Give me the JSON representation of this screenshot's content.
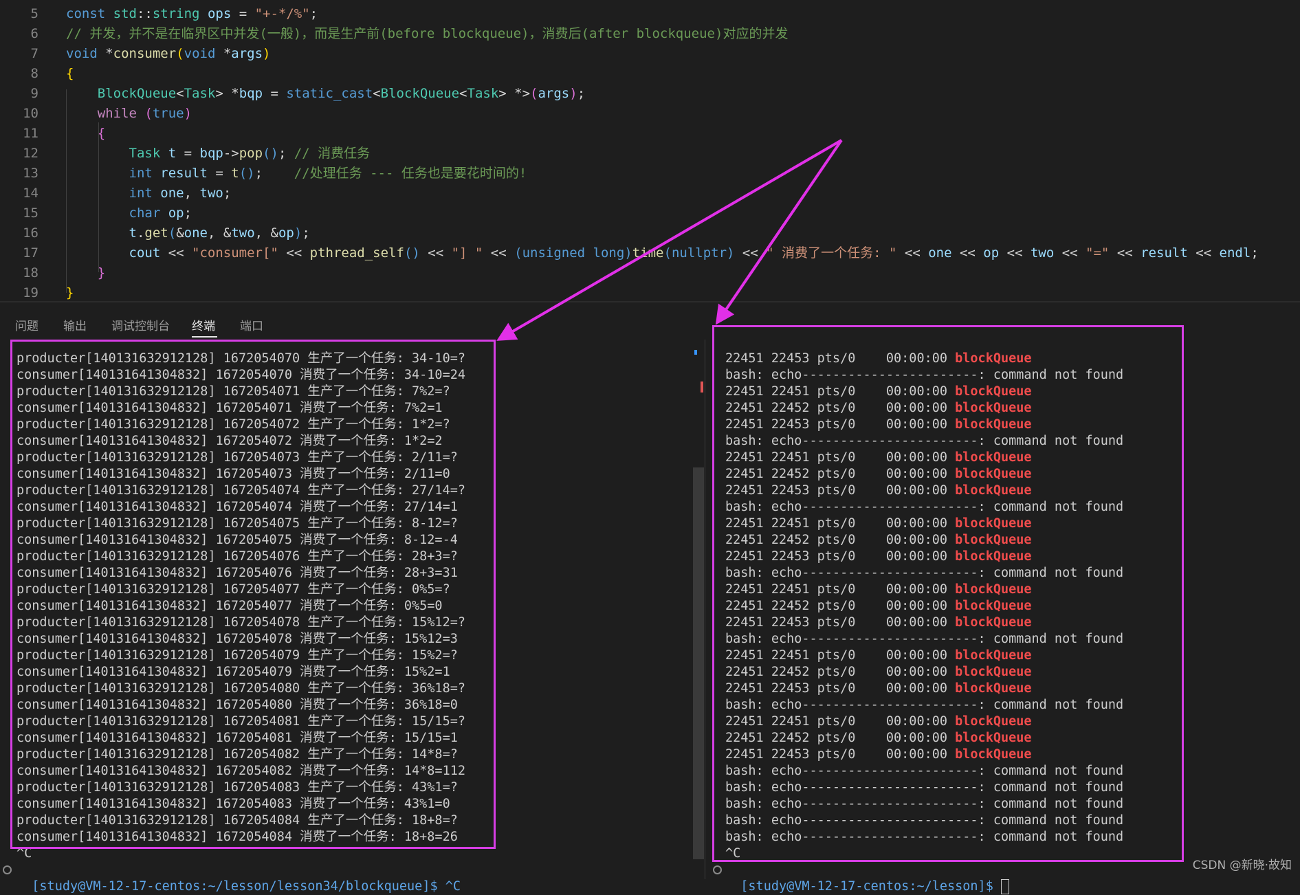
{
  "editor": {
    "lines": [
      {
        "num": "5",
        "parts": [
          [
            "kw",
            "const "
          ],
          [
            "ty",
            "std"
          ],
          [
            "pn",
            "::"
          ],
          [
            "ty",
            "string "
          ],
          [
            "vr",
            "ops"
          ],
          [
            "pn",
            " = "
          ],
          [
            "str",
            "\"+-*/%\""
          ],
          [
            "pn",
            ";"
          ]
        ]
      },
      {
        "num": "6",
        "parts": [
          [
            "cm",
            "// 并发，并不是在临界区中并发(一般)，而是生产前(before blockqueue)，消费后(after blockqueue)对应的并发"
          ]
        ]
      },
      {
        "num": "7",
        "parts": [
          [
            "kw",
            "void "
          ],
          [
            "pn",
            "*"
          ],
          [
            "fn",
            "consumer"
          ],
          [
            "br",
            "("
          ],
          [
            "kw",
            "void "
          ],
          [
            "pn",
            "*"
          ],
          [
            "vr",
            "args"
          ],
          [
            "br",
            ")"
          ]
        ]
      },
      {
        "num": "8",
        "parts": [
          [
            "br",
            "{"
          ]
        ]
      },
      {
        "num": "9",
        "parts": [
          [
            "pn",
            "    "
          ],
          [
            "ty",
            "BlockQueue"
          ],
          [
            "pn",
            "<"
          ],
          [
            "ty",
            "Task"
          ],
          [
            "pn",
            "> *"
          ],
          [
            "vr",
            "bqp"
          ],
          [
            "pn",
            " = "
          ],
          [
            "kw",
            "static_cast"
          ],
          [
            "pn",
            "<"
          ],
          [
            "ty",
            "BlockQueue"
          ],
          [
            "pn",
            "<"
          ],
          [
            "ty",
            "Task"
          ],
          [
            "pn",
            "> *>"
          ],
          [
            "br2",
            "("
          ],
          [
            "vr",
            "args"
          ],
          [
            "br2",
            ")"
          ],
          [
            "pn",
            ";"
          ]
        ]
      },
      {
        "num": "10",
        "parts": [
          [
            "pn",
            "    "
          ],
          [
            "ctl",
            "while "
          ],
          [
            "br2",
            "("
          ],
          [
            "kw",
            "true"
          ],
          [
            "br2",
            ")"
          ]
        ]
      },
      {
        "num": "11",
        "parts": [
          [
            "pn",
            "    "
          ],
          [
            "br2",
            "{"
          ]
        ]
      },
      {
        "num": "12",
        "parts": [
          [
            "pn",
            "        "
          ],
          [
            "ty",
            "Task "
          ],
          [
            "vr",
            "t"
          ],
          [
            "pn",
            " = "
          ],
          [
            "vr",
            "bqp"
          ],
          [
            "pn",
            "->"
          ],
          [
            "fn",
            "pop"
          ],
          [
            "kw",
            "()"
          ],
          [
            "pn",
            "; "
          ],
          [
            "cm",
            "// 消费任务"
          ]
        ]
      },
      {
        "num": "13",
        "parts": [
          [
            "pn",
            "        "
          ],
          [
            "kw",
            "int "
          ],
          [
            "vr",
            "result"
          ],
          [
            "pn",
            " = "
          ],
          [
            "fn",
            "t"
          ],
          [
            "kw",
            "()"
          ],
          [
            "pn",
            ";    "
          ],
          [
            "cm",
            "//处理任务 --- 任务也是要花时间的!"
          ]
        ]
      },
      {
        "num": "14",
        "parts": [
          [
            "pn",
            "        "
          ],
          [
            "kw",
            "int "
          ],
          [
            "vr",
            "one"
          ],
          [
            "pn",
            ", "
          ],
          [
            "vr",
            "two"
          ],
          [
            "pn",
            ";"
          ]
        ]
      },
      {
        "num": "15",
        "parts": [
          [
            "pn",
            "        "
          ],
          [
            "kw",
            "char "
          ],
          [
            "vr",
            "op"
          ],
          [
            "pn",
            ";"
          ]
        ]
      },
      {
        "num": "16",
        "parts": [
          [
            "pn",
            "        "
          ],
          [
            "vr",
            "t"
          ],
          [
            "pn",
            "."
          ],
          [
            "fn",
            "get"
          ],
          [
            "kw",
            "("
          ],
          [
            "pn",
            "&"
          ],
          [
            "vr",
            "one"
          ],
          [
            "pn",
            ", &"
          ],
          [
            "vr",
            "two"
          ],
          [
            "pn",
            ", &"
          ],
          [
            "vr",
            "op"
          ],
          [
            "kw",
            ")"
          ],
          [
            "pn",
            ";"
          ]
        ]
      },
      {
        "num": "17",
        "parts": [
          [
            "pn",
            "        "
          ],
          [
            "vr",
            "cout"
          ],
          [
            "pn",
            " << "
          ],
          [
            "str",
            "\"consumer[\""
          ],
          [
            "pn",
            " << "
          ],
          [
            "fn",
            "pthread_self"
          ],
          [
            "kw",
            "()"
          ],
          [
            "pn",
            " << "
          ],
          [
            "str",
            "\"] \""
          ],
          [
            "pn",
            " << "
          ],
          [
            "kw",
            "(unsigned long)"
          ],
          [
            "fn",
            "time"
          ],
          [
            "kw",
            "("
          ],
          [
            "kw",
            "nullptr"
          ],
          [
            "kw",
            ")"
          ],
          [
            "pn",
            " << "
          ],
          [
            "str",
            "\" 消费了一个任务: \""
          ],
          [
            "pn",
            " << "
          ],
          [
            "vr",
            "one"
          ],
          [
            "pn",
            " << "
          ],
          [
            "vr",
            "op"
          ],
          [
            "pn",
            " << "
          ],
          [
            "vr",
            "two"
          ],
          [
            "pn",
            " << "
          ],
          [
            "str",
            "\"=\""
          ],
          [
            "pn",
            " << "
          ],
          [
            "vr",
            "result"
          ],
          [
            "pn",
            " << "
          ],
          [
            "vr",
            "endl"
          ],
          [
            "pn",
            ";"
          ]
        ]
      },
      {
        "num": "18",
        "parts": [
          [
            "pn",
            "    "
          ],
          [
            "br2",
            "}"
          ]
        ]
      },
      {
        "num": "19",
        "parts": [
          [
            "br",
            "}"
          ]
        ]
      }
    ]
  },
  "panel_tabs": [
    "问题",
    "输出",
    "调试控制台",
    "终端",
    "端口"
  ],
  "active_tab": "终端",
  "left_terminal": {
    "lines": [
      "producter[140131632912128] 1672054070 生产了一个任务: 34-10=?",
      "consumer[140131641304832] 1672054070 消费了一个任务: 34-10=24",
      "producter[140131632912128] 1672054071 生产了一个任务: 7%2=?",
      "consumer[140131641304832] 1672054071 消费了一个任务: 7%2=1",
      "producter[140131632912128] 1672054072 生产了一个任务: 1*2=?",
      "consumer[140131641304832] 1672054072 消费了一个任务: 1*2=2",
      "producter[140131632912128] 1672054073 生产了一个任务: 2/11=?",
      "consumer[140131641304832] 1672054073 消费了一个任务: 2/11=0",
      "producter[140131632912128] 1672054074 生产了一个任务: 27/14=?",
      "consumer[140131641304832] 1672054074 消费了一个任务: 27/14=1",
      "producter[140131632912128] 1672054075 生产了一个任务: 8-12=?",
      "consumer[140131641304832] 1672054075 消费了一个任务: 8-12=-4",
      "producter[140131632912128] 1672054076 生产了一个任务: 28+3=?",
      "consumer[140131641304832] 1672054076 消费了一个任务: 28+3=31",
      "producter[140131632912128] 1672054077 生产了一个任务: 0%5=?",
      "consumer[140131641304832] 1672054077 消费了一个任务: 0%5=0",
      "producter[140131632912128] 1672054078 生产了一个任务: 15%12=?",
      "consumer[140131641304832] 1672054078 消费了一个任务: 15%12=3",
      "producter[140131632912128] 1672054079 生产了一个任务: 15%2=?",
      "consumer[140131641304832] 1672054079 消费了一个任务: 15%2=1",
      "producter[140131632912128] 1672054080 生产了一个任务: 36%18=?",
      "consumer[140131641304832] 1672054080 消费了一个任务: 36%18=0",
      "producter[140131632912128] 1672054081 生产了一个任务: 15/15=?",
      "consumer[140131641304832] 1672054081 消费了一个任务: 15/15=1",
      "producter[140131632912128] 1672054082 生产了一个任务: 14*8=?",
      "consumer[140131641304832] 1672054082 消费了一个任务: 14*8=112",
      "producter[140131632912128] 1672054083 生产了一个任务: 43%1=?",
      "consumer[140131641304832] 1672054083 消费了一个任务: 43%1=0",
      "producter[140131632912128] 1672054084 生产了一个任务: 18+8=?",
      "consumer[140131641304832] 1672054084 消费了一个任务: 18+8=26",
      "^C"
    ],
    "prompt": "[study@VM-12-17-centos:~/lesson/lesson34/blockqueue]$ ^C"
  },
  "right_terminal": {
    "lines": [
      {
        "text": "22451 22453 pts/0    00:00:00 ",
        "red": "blockQueue"
      },
      {
        "text": "bash: echo-----------------------: command not found",
        "red": ""
      },
      {
        "text": "22451 22451 pts/0    00:00:00 ",
        "red": "blockQueue"
      },
      {
        "text": "22451 22452 pts/0    00:00:00 ",
        "red": "blockQueue"
      },
      {
        "text": "22451 22453 pts/0    00:00:00 ",
        "red": "blockQueue"
      },
      {
        "text": "bash: echo-----------------------: command not found",
        "red": ""
      },
      {
        "text": "22451 22451 pts/0    00:00:00 ",
        "red": "blockQueue"
      },
      {
        "text": "22451 22452 pts/0    00:00:00 ",
        "red": "blockQueue"
      },
      {
        "text": "22451 22453 pts/0    00:00:00 ",
        "red": "blockQueue"
      },
      {
        "text": "bash: echo-----------------------: command not found",
        "red": ""
      },
      {
        "text": "22451 22451 pts/0    00:00:00 ",
        "red": "blockQueue"
      },
      {
        "text": "22451 22452 pts/0    00:00:00 ",
        "red": "blockQueue"
      },
      {
        "text": "22451 22453 pts/0    00:00:00 ",
        "red": "blockQueue"
      },
      {
        "text": "bash: echo-----------------------: command not found",
        "red": ""
      },
      {
        "text": "22451 22451 pts/0    00:00:00 ",
        "red": "blockQueue"
      },
      {
        "text": "22451 22452 pts/0    00:00:00 ",
        "red": "blockQueue"
      },
      {
        "text": "22451 22453 pts/0    00:00:00 ",
        "red": "blockQueue"
      },
      {
        "text": "bash: echo-----------------------: command not found",
        "red": ""
      },
      {
        "text": "22451 22451 pts/0    00:00:00 ",
        "red": "blockQueue"
      },
      {
        "text": "22451 22452 pts/0    00:00:00 ",
        "red": "blockQueue"
      },
      {
        "text": "22451 22453 pts/0    00:00:00 ",
        "red": "blockQueue"
      },
      {
        "text": "bash: echo-----------------------: command not found",
        "red": ""
      },
      {
        "text": "22451 22451 pts/0    00:00:00 ",
        "red": "blockQueue"
      },
      {
        "text": "22451 22452 pts/0    00:00:00 ",
        "red": "blockQueue"
      },
      {
        "text": "22451 22453 pts/0    00:00:00 ",
        "red": "blockQueue"
      },
      {
        "text": "bash: echo-----------------------: command not found",
        "red": ""
      },
      {
        "text": "bash: echo-----------------------: command not found",
        "red": ""
      },
      {
        "text": "bash: echo-----------------------: command not found",
        "red": ""
      },
      {
        "text": "bash: echo-----------------------: command not found",
        "red": ""
      },
      {
        "text": "bash: echo-----------------------: command not found",
        "red": ""
      },
      {
        "text": "^C",
        "red": ""
      }
    ],
    "prompt": "[study@VM-12-17-centos:~/lesson]$ "
  },
  "watermark": "CSDN @新晓·故知",
  "colors": {
    "highlight_box": "#d63ee4",
    "process_name": "#f14c4c",
    "background": "#1e1e1e"
  }
}
